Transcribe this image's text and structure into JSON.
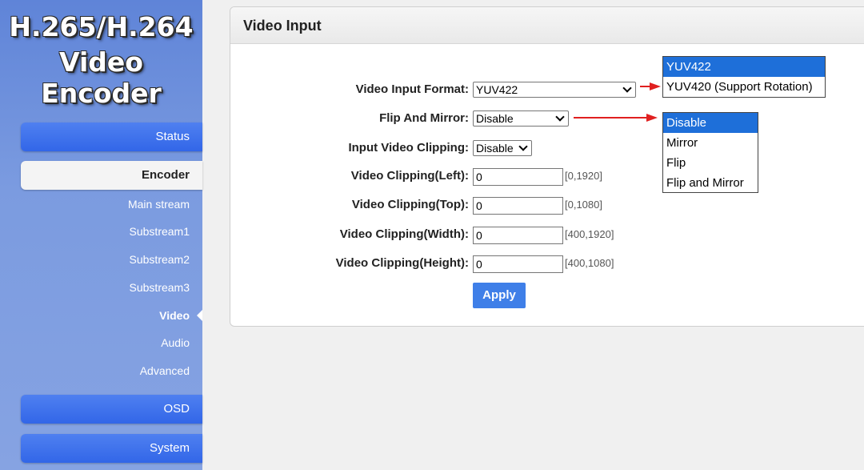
{
  "sidebar": {
    "logo_line1": "H.265/H.264",
    "logo_line2": "Video Encoder",
    "nav": {
      "status": "Status",
      "encoder": "Encoder",
      "osd": "OSD",
      "system": "System"
    },
    "encoder_items": [
      "Main stream",
      "Substream1",
      "Substream2",
      "Substream3",
      "Video",
      "Audio",
      "Advanced"
    ],
    "selected_item": "Video"
  },
  "panel": {
    "title": "Video Input",
    "fields": {
      "input_format": {
        "label": "Video Input Format:",
        "value": "YUV422"
      },
      "flip_mirror": {
        "label": "Flip And Mirror:",
        "value": "Disable"
      },
      "clipping": {
        "label": "Input Video Clipping:",
        "value": "Disable"
      },
      "clip_left": {
        "label": "Video Clipping(Left):",
        "value": "0",
        "range": "[0,1920]"
      },
      "clip_top": {
        "label": "Video Clipping(Top):",
        "value": "0",
        "range": "[0,1080]"
      },
      "clip_width": {
        "label": "Video Clipping(Width):",
        "value": "0",
        "range": "[400,1920]"
      },
      "clip_height": {
        "label": "Video Clipping(Height):",
        "value": "0",
        "range": "[400,1080]"
      }
    },
    "apply_label": "Apply"
  },
  "popups": {
    "format_options": [
      "YUV422",
      "YUV420 (Support Rotation)"
    ],
    "format_highlight": "YUV422",
    "flip_options": [
      "Disable",
      "Mirror",
      "Flip",
      "Flip and Mirror"
    ],
    "flip_highlight": "Disable"
  },
  "colors": {
    "sidebar": "#6f90dc",
    "nav_button": "#3a6fec",
    "apply_button": "#3f7fe8",
    "highlight": "#1e6fd9",
    "arrow": "#e02020"
  }
}
